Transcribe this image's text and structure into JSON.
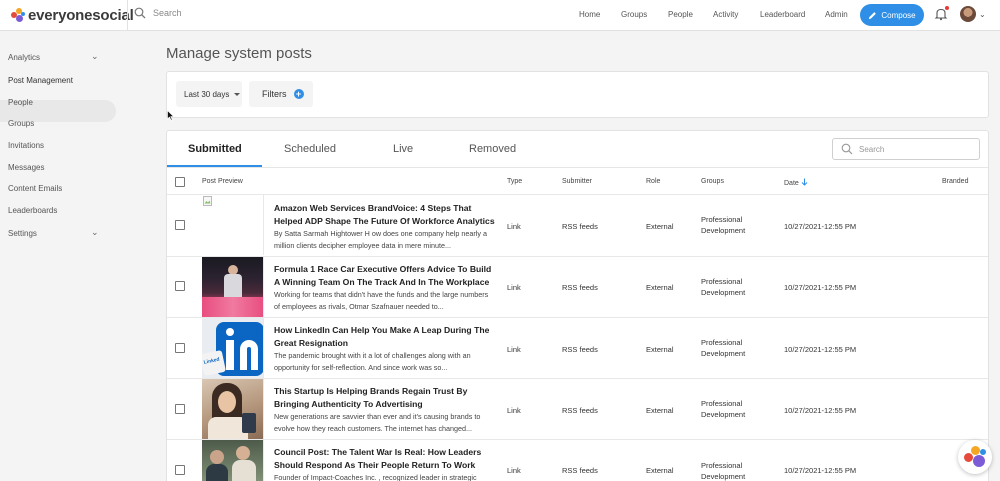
{
  "brand": {
    "logo_text": "everyonesocial",
    "colors": {
      "accent": "#2f8fe6",
      "dot_red": "#e64a3b",
      "dot_orange": "#f5a623",
      "dot_purple": "#7b5cd6",
      "dot_blue": "#2f8fe6"
    }
  },
  "topbar": {
    "search_placeholder": "Search",
    "nav": [
      "Home",
      "Groups",
      "People",
      "Activity",
      "Leaderboard",
      "Admin"
    ],
    "compose_label": "Compose"
  },
  "sidebar": {
    "items": [
      {
        "label": "Analytics",
        "expandable": true
      },
      {
        "label": "Post Management",
        "active": true
      },
      {
        "label": "People"
      },
      {
        "label": "Groups"
      },
      {
        "label": "Invitations"
      },
      {
        "label": "Messages"
      },
      {
        "label": "Content Emails"
      },
      {
        "label": "Leaderboards"
      },
      {
        "label": "Settings",
        "expandable": true
      }
    ]
  },
  "page": {
    "title": "Manage system posts",
    "date_range": "Last 30 days",
    "filters_label": "Filters"
  },
  "tabs": [
    "Submitted",
    "Scheduled",
    "Live",
    "Removed"
  ],
  "active_tab": "Submitted",
  "table_search_placeholder": "Search",
  "columns": [
    "Post Preview",
    "Type",
    "Submitter",
    "Role",
    "Groups",
    "Date",
    "Branded"
  ],
  "sort_column": "Date",
  "rows": [
    {
      "title": "Amazon Web Services BrandVoice: 4 Steps That Helped ADP Shape The Future Of Workforce Analytics",
      "excerpt": "By Satta Sarmah Hightower H ow does one company help nearly a million clients decipher employee data in mere minute...",
      "type": "Link",
      "submitter": "RSS feeds",
      "role": "External",
      "groups": "Professional Development",
      "date": "10/27/2021-12:55 PM",
      "thumb": "broken-image"
    },
    {
      "title": "Formula 1 Race Car Executive Offers Advice To Build A Winning Team On The Track And In The Workplace",
      "excerpt": "Working for teams that didn't have the funds and the large numbers of employees as rivals, Otmar Szafnauer needed to...",
      "type": "Link",
      "submitter": "RSS feeds",
      "role": "External",
      "groups": "Professional Development",
      "date": "10/27/2021-12:55 PM",
      "thumb": "f1-photo"
    },
    {
      "title": "How LinkedIn Can Help You Make A Leap During The Great Resignation",
      "excerpt": "The pandemic brought with it a lot of challenges along with an opportunity for self-reflection. And since work was so...",
      "type": "Link",
      "submitter": "RSS feeds",
      "role": "External",
      "groups": "Professional Development",
      "date": "10/27/2021-12:55 PM",
      "thumb": "linkedin-photo"
    },
    {
      "title": "This Startup Is Helping Brands Regain Trust By Bringing Authenticity To Advertising",
      "excerpt": "New generations are savvier than ever and it's causing brands to evolve how they reach customers. The internet has changed...",
      "type": "Link",
      "submitter": "RSS feeds",
      "role": "External",
      "groups": "Professional Development",
      "date": "10/27/2021-12:55 PM",
      "thumb": "startup-photo"
    },
    {
      "title": "Council Post: The Talent War Is Real: How Leaders Should Respond As Their People Return To Work",
      "excerpt": "Founder of Impact-Coaches Inc. , recognized leader in strategic",
      "type": "Link",
      "submitter": "RSS feeds",
      "role": "External",
      "groups": "Professional Development",
      "date": "10/27/2021-12:55 PM",
      "thumb": "council-photo"
    }
  ]
}
